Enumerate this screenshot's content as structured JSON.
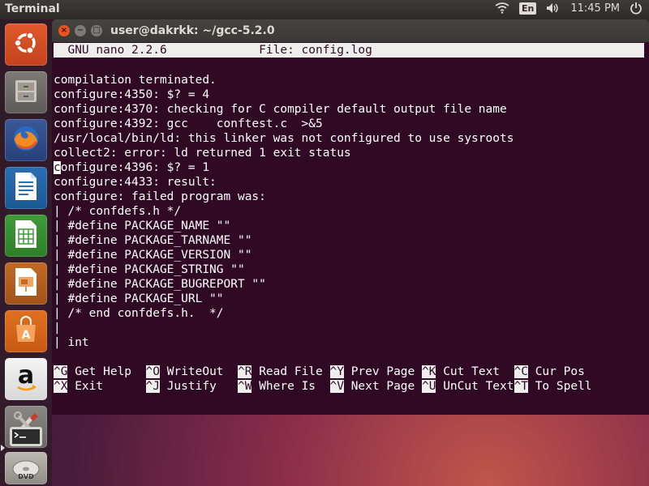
{
  "top_panel": {
    "app_title": "Terminal",
    "language": "En",
    "clock": "11:45 PM",
    "icons": [
      "wifi-icon",
      "volume-icon",
      "power-icon"
    ]
  },
  "launcher": {
    "items": [
      {
        "name": "ubuntu-dash",
        "icon": "ubuntu-logo-icon"
      },
      {
        "name": "files",
        "icon": "file-cabinet-icon"
      },
      {
        "name": "firefox",
        "icon": "firefox-icon"
      },
      {
        "name": "libreoffice-writer",
        "icon": "writer-document-icon"
      },
      {
        "name": "libreoffice-calc",
        "icon": "calc-spreadsheet-icon"
      },
      {
        "name": "libreoffice-impress",
        "icon": "impress-presentation-icon"
      },
      {
        "name": "software-center",
        "icon": "shopping-bag-icon"
      },
      {
        "name": "amazon",
        "icon": "amazon-icon"
      },
      {
        "name": "system-settings",
        "icon": "settings-tools-icon"
      },
      {
        "name": "terminal",
        "icon": "terminal-icon"
      },
      {
        "name": "dvd",
        "icon": "dvd-icon"
      }
    ],
    "amazon_letter": "a"
  },
  "window": {
    "title": "user@dakrkk: ~/gcc-5.2.0",
    "close_glyph": "×",
    "minimize_glyph": "−",
    "maximize_glyph": "□"
  },
  "nano": {
    "header": "  GNU nano 2.2.6             File: config.log                                  ",
    "lines": [
      "compilation terminated.",
      "configure:4350: $? = 4",
      "configure:4370: checking for C compiler default output file name",
      "configure:4392: gcc    conftest.c  >&5",
      "/usr/local/bin/ld: this linker was not configured to use sysroots",
      "collect2: error: ld returned 1 exit status",
      "onfigure:4396: $? = 1",
      "configure:4433: result:",
      "configure: failed program was:",
      "| /* confdefs.h */",
      "| #define PACKAGE_NAME \"\"",
      "| #define PACKAGE_TARNAME \"\"",
      "| #define PACKAGE_VERSION \"\"",
      "| #define PACKAGE_STRING \"\"",
      "| #define PACKAGE_BUGREPORT \"\"",
      "| #define PACKAGE_URL \"\"",
      "| /* end confdefs.h.  */",
      "|",
      "| int"
    ],
    "cursor_char": "c",
    "shortcuts_row1": [
      {
        "key": "^G",
        "label": " Get Help  "
      },
      {
        "key": "^O",
        "label": " WriteOut  "
      },
      {
        "key": "^R",
        "label": " Read File "
      },
      {
        "key": "^Y",
        "label": " Prev Page "
      },
      {
        "key": "^K",
        "label": " Cut Text  "
      },
      {
        "key": "^C",
        "label": " Cur Pos"
      }
    ],
    "shortcuts_row2": [
      {
        "key": "^X",
        "label": " Exit      "
      },
      {
        "key": "^J",
        "label": " Justify   "
      },
      {
        "key": "^W",
        "label": " Where Is  "
      },
      {
        "key": "^V",
        "label": " Next Page "
      },
      {
        "key": "^U",
        "label": " UnCut Text"
      },
      {
        "key": "^T",
        "label": " To Spell"
      }
    ]
  }
}
